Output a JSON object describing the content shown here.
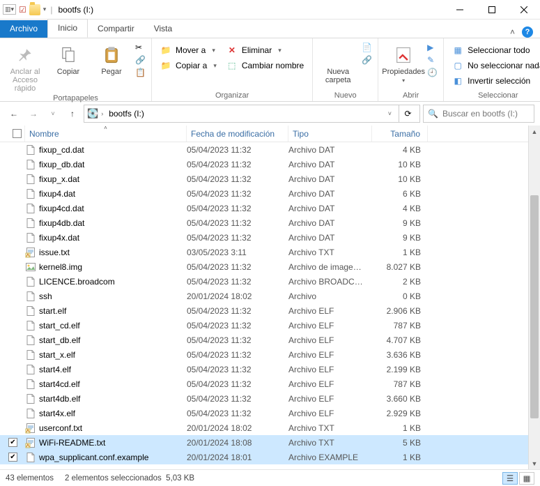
{
  "title": "bootfs (I:)",
  "tabs": {
    "file": "Archivo",
    "home": "Inicio",
    "share": "Compartir",
    "view": "Vista"
  },
  "ribbon": {
    "clipboard": {
      "caption": "Portapapeles",
      "pin": "Anclar al Acceso rápido",
      "copy": "Copiar",
      "paste": "Pegar"
    },
    "organize": {
      "caption": "Organizar",
      "moveTo": "Mover a",
      "copyTo": "Copiar a",
      "delete": "Eliminar",
      "rename": "Cambiar nombre"
    },
    "new": {
      "caption": "Nuevo",
      "newFolder": "Nueva carpeta"
    },
    "open": {
      "caption": "Abrir",
      "properties": "Propiedades"
    },
    "select": {
      "caption": "Seleccionar",
      "all": "Seleccionar todo",
      "none": "No seleccionar nada",
      "invert": "Invertir selección"
    }
  },
  "breadcrumb": {
    "location": "bootfs (I:)"
  },
  "search": {
    "placeholder": "Buscar en bootfs (I:)"
  },
  "columns": {
    "name": "Nombre",
    "date": "Fecha de modificación",
    "type": "Tipo",
    "size": "Tamaño"
  },
  "files": [
    {
      "name": "fixup_cd.dat",
      "date": "05/04/2023 11:32",
      "type": "Archivo DAT",
      "size": "4 KB",
      "icon": "file",
      "sel": false
    },
    {
      "name": "fixup_db.dat",
      "date": "05/04/2023 11:32",
      "type": "Archivo DAT",
      "size": "10 KB",
      "icon": "file",
      "sel": false
    },
    {
      "name": "fixup_x.dat",
      "date": "05/04/2023 11:32",
      "type": "Archivo DAT",
      "size": "10 KB",
      "icon": "file",
      "sel": false
    },
    {
      "name": "fixup4.dat",
      "date": "05/04/2023 11:32",
      "type": "Archivo DAT",
      "size": "6 KB",
      "icon": "file",
      "sel": false
    },
    {
      "name": "fixup4cd.dat",
      "date": "05/04/2023 11:32",
      "type": "Archivo DAT",
      "size": "4 KB",
      "icon": "file",
      "sel": false
    },
    {
      "name": "fixup4db.dat",
      "date": "05/04/2023 11:32",
      "type": "Archivo DAT",
      "size": "9 KB",
      "icon": "file",
      "sel": false
    },
    {
      "name": "fixup4x.dat",
      "date": "05/04/2023 11:32",
      "type": "Archivo DAT",
      "size": "9 KB",
      "icon": "file",
      "sel": false
    },
    {
      "name": "issue.txt",
      "date": "03/05/2023 3:11",
      "type": "Archivo TXT",
      "size": "1 KB",
      "icon": "txt",
      "sel": false
    },
    {
      "name": "kernel8.img",
      "date": "05/04/2023 11:32",
      "type": "Archivo de image…",
      "size": "8.027 KB",
      "icon": "img",
      "sel": false
    },
    {
      "name": "LICENCE.broadcom",
      "date": "05/04/2023 11:32",
      "type": "Archivo BROADC…",
      "size": "2 KB",
      "icon": "file",
      "sel": false
    },
    {
      "name": "ssh",
      "date": "20/01/2024 18:02",
      "type": "Archivo",
      "size": "0 KB",
      "icon": "file",
      "sel": false
    },
    {
      "name": "start.elf",
      "date": "05/04/2023 11:32",
      "type": "Archivo ELF",
      "size": "2.906 KB",
      "icon": "file",
      "sel": false
    },
    {
      "name": "start_cd.elf",
      "date": "05/04/2023 11:32",
      "type": "Archivo ELF",
      "size": "787 KB",
      "icon": "file",
      "sel": false
    },
    {
      "name": "start_db.elf",
      "date": "05/04/2023 11:32",
      "type": "Archivo ELF",
      "size": "4.707 KB",
      "icon": "file",
      "sel": false
    },
    {
      "name": "start_x.elf",
      "date": "05/04/2023 11:32",
      "type": "Archivo ELF",
      "size": "3.636 KB",
      "icon": "file",
      "sel": false
    },
    {
      "name": "start4.elf",
      "date": "05/04/2023 11:32",
      "type": "Archivo ELF",
      "size": "2.199 KB",
      "icon": "file",
      "sel": false
    },
    {
      "name": "start4cd.elf",
      "date": "05/04/2023 11:32",
      "type": "Archivo ELF",
      "size": "787 KB",
      "icon": "file",
      "sel": false
    },
    {
      "name": "start4db.elf",
      "date": "05/04/2023 11:32",
      "type": "Archivo ELF",
      "size": "3.660 KB",
      "icon": "file",
      "sel": false
    },
    {
      "name": "start4x.elf",
      "date": "05/04/2023 11:32",
      "type": "Archivo ELF",
      "size": "2.929 KB",
      "icon": "file",
      "sel": false
    },
    {
      "name": "userconf.txt",
      "date": "20/01/2024 18:02",
      "type": "Archivo TXT",
      "size": "1 KB",
      "icon": "txt",
      "sel": false
    },
    {
      "name": "WiFi-README.txt",
      "date": "20/01/2024 18:08",
      "type": "Archivo TXT",
      "size": "5 KB",
      "icon": "txt",
      "sel": true
    },
    {
      "name": "wpa_supplicant.conf.example",
      "date": "20/01/2024 18:01",
      "type": "Archivo EXAMPLE",
      "size": "1 KB",
      "icon": "file",
      "sel": true
    }
  ],
  "status": {
    "count": "43 elementos",
    "selected": "2 elementos seleccionados",
    "size": "5,03 KB"
  }
}
